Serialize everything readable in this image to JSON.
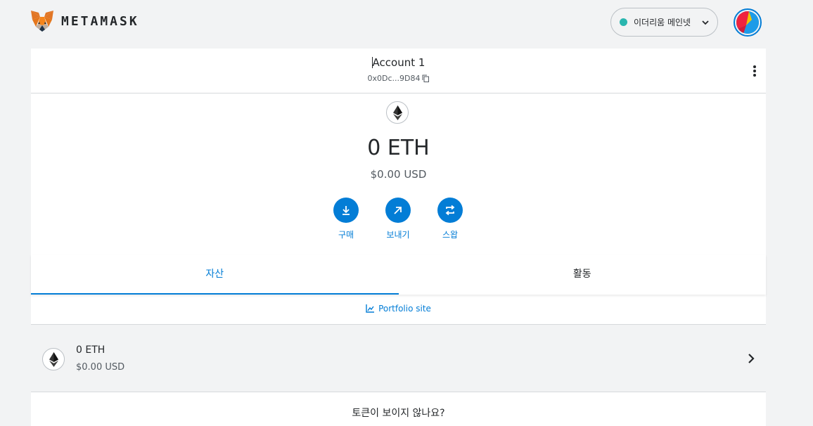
{
  "header": {
    "brand": "METAMASK",
    "network_label": "이더리움 메인넷",
    "network_color": "#29b6af",
    "accent_color": "#037dd6"
  },
  "account": {
    "name": "Account 1",
    "address": "0x0Dc...9D84"
  },
  "balance": {
    "amount": "0 ETH",
    "usd": "$0.00 USD"
  },
  "actions": [
    {
      "label": "구매",
      "icon": "download-icon"
    },
    {
      "label": "보내기",
      "icon": "arrow-up-right-icon"
    },
    {
      "label": "스왑",
      "icon": "swap-icon"
    }
  ],
  "tabs": [
    {
      "label": "자산",
      "active": true
    },
    {
      "label": "활동",
      "active": false
    }
  ],
  "portfolio_link": "Portfolio site",
  "assets": [
    {
      "name": "0 ETH",
      "usd": "$0.00 USD",
      "icon": "eth-icon"
    }
  ],
  "help_text": "토큰이 보이지 않나요?"
}
